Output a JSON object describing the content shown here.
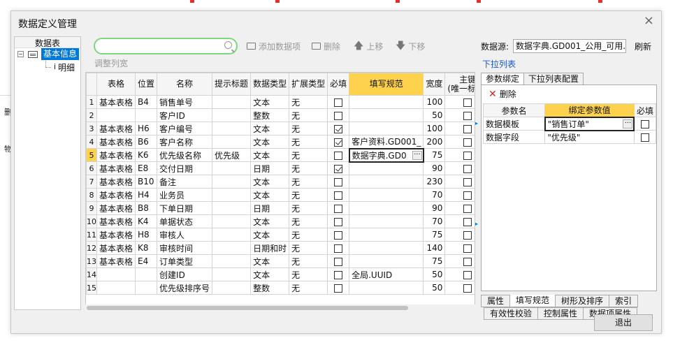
{
  "window": {
    "title": "数据定义管理",
    "close": "×"
  },
  "tree": {
    "header": "数据表",
    "root": "基本信息",
    "child": "明细"
  },
  "search": {
    "placeholder": ""
  },
  "toolbar": {
    "add": "添加数据项",
    "delete": "删除",
    "up": "上移",
    "down": "下移",
    "adjust": "调整列宽"
  },
  "grid": {
    "headers": [
      "表格",
      "位置",
      "名称",
      "提示标题",
      "数据类型",
      "扩展类型",
      "必填",
      "填写规范",
      "宽度",
      "主键\n(唯一标识)"
    ],
    "rows": [
      {
        "n": "1",
        "table": "基本表格",
        "pos": "B4",
        "name": "销售单号",
        "hint": "",
        "type": "文本",
        "ext": "无",
        "req": false,
        "spec": "",
        "width": "100",
        "pk": false
      },
      {
        "n": "2",
        "table": "",
        "pos": "",
        "name": "客户ID",
        "hint": "",
        "type": "整数",
        "ext": "无",
        "req": false,
        "spec": "",
        "width": "50",
        "pk": false
      },
      {
        "n": "3",
        "table": "基本表格",
        "pos": "H6",
        "name": "客户编号",
        "hint": "",
        "type": "文本",
        "ext": "无",
        "req": true,
        "spec": "",
        "width": "100",
        "pk": false
      },
      {
        "n": "4",
        "table": "基本表格",
        "pos": "B6",
        "name": "客户名称",
        "hint": "",
        "type": "文本",
        "ext": "无",
        "req": true,
        "spec": "客户资料.GD001_",
        "width": "200",
        "pk": false
      },
      {
        "n": "5",
        "table": "基本表格",
        "pos": "K6",
        "name": "优先级名称",
        "hint": "优先级",
        "type": "文本",
        "ext": "无",
        "req": false,
        "spec": "数据字典.GD0",
        "width": "75",
        "pk": false
      },
      {
        "n": "6",
        "table": "基本表格",
        "pos": "E8",
        "name": "交付日期",
        "hint": "",
        "type": "日期",
        "ext": "无",
        "req": true,
        "spec": "",
        "width": "90",
        "pk": false
      },
      {
        "n": "7",
        "table": "基本表格",
        "pos": "B10",
        "name": "备注",
        "hint": "",
        "type": "文本",
        "ext": "无",
        "req": false,
        "spec": "",
        "width": "230",
        "pk": false
      },
      {
        "n": "8",
        "table": "基本表格",
        "pos": "H4",
        "name": "业务员",
        "hint": "",
        "type": "文本",
        "ext": "无",
        "req": false,
        "spec": "",
        "width": "70",
        "pk": false
      },
      {
        "n": "9",
        "table": "基本表格",
        "pos": "B8",
        "name": "下单日期",
        "hint": "",
        "type": "日期",
        "ext": "无",
        "req": false,
        "spec": "",
        "width": "90",
        "pk": false
      },
      {
        "n": "10",
        "table": "基本表格",
        "pos": "K4",
        "name": "单据状态",
        "hint": "",
        "type": "文本",
        "ext": "无",
        "req": false,
        "spec": "",
        "width": "70",
        "pk": false
      },
      {
        "n": "11",
        "table": "基本表格",
        "pos": "H8",
        "name": "审核人",
        "hint": "",
        "type": "文本",
        "ext": "无",
        "req": false,
        "spec": "",
        "width": "75",
        "pk": false
      },
      {
        "n": "12",
        "table": "基本表格",
        "pos": "K8",
        "name": "审核时间",
        "hint": "",
        "type": "日期和时",
        "ext": "无",
        "req": false,
        "spec": "",
        "width": "140",
        "pk": false
      },
      {
        "n": "13",
        "table": "基本表格",
        "pos": "E4",
        "name": "订单类型",
        "hint": "",
        "type": "文本",
        "ext": "无",
        "req": false,
        "spec": "",
        "width": "75",
        "pk": false
      },
      {
        "n": "14",
        "table": "",
        "pos": "",
        "name": "创建ID",
        "hint": "",
        "type": "文本",
        "ext": "无",
        "req": false,
        "spec": "全局.UUID",
        "width": "50",
        "pk": false
      },
      {
        "n": "15",
        "table": "",
        "pos": "",
        "name": "优先级排序号",
        "hint": "",
        "type": "整数",
        "ext": "无",
        "req": false,
        "spec": "",
        "width": "50",
        "pk": false
      }
    ]
  },
  "right": {
    "ds_label": "数据源:",
    "ds_value": "数据字典.GD001_公用_可用...",
    "refresh": "刷新",
    "dropdown_list": "下拉列表",
    "tabs": [
      "参数绑定",
      "下拉列表配置"
    ],
    "delete": "删除",
    "param_headers": [
      "参数名",
      "绑定参数值",
      "必填"
    ],
    "params": [
      {
        "name": "数据模板",
        "value": "\"销售订单\"",
        "req": false
      },
      {
        "name": "数据字段",
        "value": "\"优先级\"",
        "req": false
      }
    ],
    "bottom_tabs1": [
      "属性",
      "填写规范",
      "树形及排序",
      "索引"
    ],
    "bottom_tabs2": [
      "有效性校验",
      "控制属性",
      "数据项属性"
    ]
  },
  "footer": {
    "exit": "退出"
  },
  "background": {
    "left_labels": [
      "删",
      "物"
    ]
  }
}
